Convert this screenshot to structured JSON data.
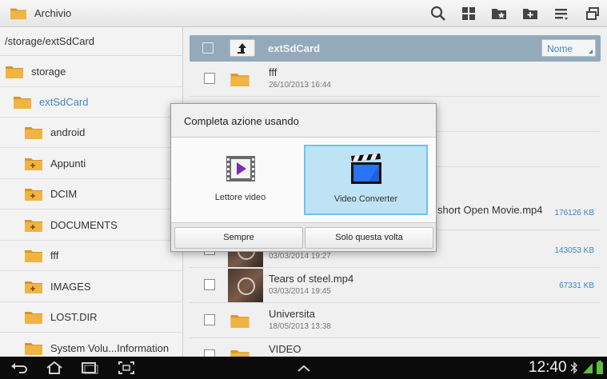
{
  "actionbar": {
    "title": "Archivio",
    "icons": [
      "search-icon",
      "grid-view-icon",
      "favorite-folder-icon",
      "new-folder-icon",
      "menu-list-icon",
      "window-icon"
    ]
  },
  "left_pane": {
    "path": "/storage/extSdCard",
    "tree": [
      {
        "label": "storage",
        "icon": "folder-icon"
      },
      {
        "label": "extSdCard",
        "icon": "folder-icon",
        "selected": true
      },
      {
        "label": "android",
        "icon": "folder-icon"
      },
      {
        "label": "Appunti",
        "icon": "folder-plus-icon"
      },
      {
        "label": "DCIM",
        "icon": "folder-plus-icon"
      },
      {
        "label": "DOCUMENTS",
        "icon": "folder-plus-icon"
      },
      {
        "label": "fff",
        "icon": "folder-icon"
      },
      {
        "label": "IMAGES",
        "icon": "folder-plus-icon"
      },
      {
        "label": "LOST.DIR",
        "icon": "folder-icon"
      },
      {
        "label": "System Volu...Information",
        "icon": "folder-icon"
      }
    ]
  },
  "right_pane": {
    "header_title": "extSdCard",
    "sort_label": "Nome",
    "files": [
      {
        "name": "fff",
        "date": "26/10/2013 16:44",
        "size": "",
        "type": "folder"
      },
      {
        "name": "short Open Movie.mp4",
        "date": "",
        "size": "176126 KB",
        "type": "video-hidden"
      },
      {
        "name": "",
        "date": "03/03/2014 19:27",
        "size": "143053 KB",
        "type": "video"
      },
      {
        "name": "Tears of steel.mp4",
        "date": "03/03/2014 19:45",
        "size": "67331 KB",
        "type": "video"
      },
      {
        "name": "Universita",
        "date": "18/05/2013 13:38",
        "size": "",
        "type": "folder"
      },
      {
        "name": "VIDEO",
        "date": "",
        "size": "",
        "type": "folder"
      }
    ]
  },
  "dialog": {
    "title": "Completa azione usando",
    "options": [
      {
        "label": "Lettore video",
        "icon": "video-player-icon",
        "selected": false
      },
      {
        "label": "Video Converter",
        "icon": "clapperboard-icon",
        "selected": true
      }
    ],
    "buttons": {
      "always": "Sempre",
      "just_once": "Solo questa volta"
    }
  },
  "navbar": {
    "time": "12:40",
    "icons": [
      "back-icon",
      "home-icon",
      "recent-apps-icon",
      "screenshot-icon",
      "up-chevron-icon",
      "bluetooth-icon",
      "signal-icon",
      "battery-icon"
    ]
  },
  "colors": {
    "accent": "#3d86c6",
    "header_bar": "#93aabb",
    "selection": "#bde3f5",
    "folder": "#e9a93a"
  }
}
